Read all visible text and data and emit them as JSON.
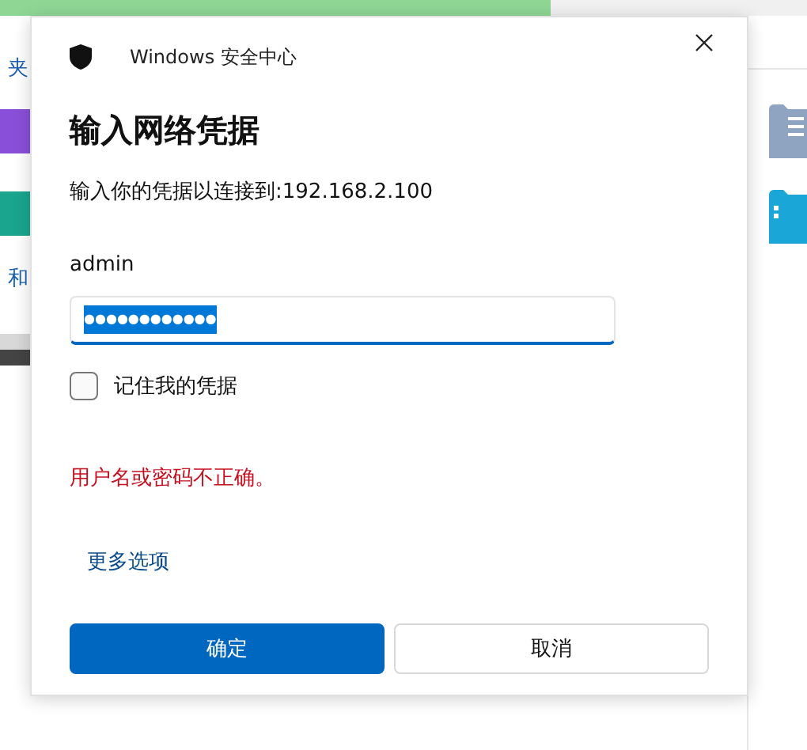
{
  "background": {
    "left_texts": [
      "夹",
      "和"
    ]
  },
  "dialog": {
    "app_title": "Windows 安全中心",
    "heading": "输入网络凭据",
    "message": "输入你的凭据以连接到:192.168.2.100",
    "username": "admin",
    "password": {
      "value": "●●●●●●●●●●●●",
      "selected": true
    },
    "remember": {
      "label": "记住我的凭据",
      "checked": false
    },
    "error": "用户名或密码不正确。",
    "more_options": "更多选项",
    "buttons": [
      {
        "label": "确定",
        "kind": "primary"
      },
      {
        "label": "取消",
        "kind": "secondary"
      }
    ]
  }
}
